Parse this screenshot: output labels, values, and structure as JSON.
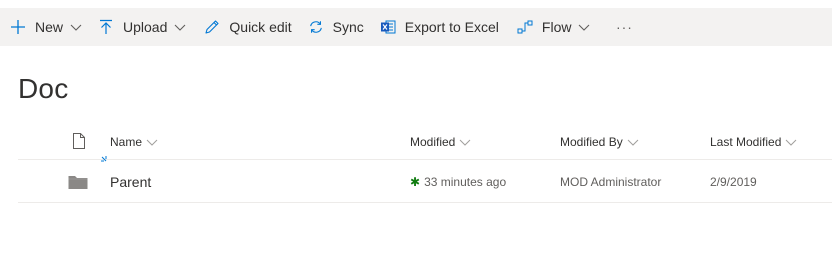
{
  "command_bar": {
    "new_label": "New",
    "upload_label": "Upload",
    "quick_edit_label": "Quick edit",
    "sync_label": "Sync",
    "export_label": "Export to Excel",
    "flow_label": "Flow",
    "more_label": "···"
  },
  "library": {
    "title": "Doc"
  },
  "columns": {
    "name": "Name",
    "modified": "Modified",
    "modified_by": "Modified By",
    "last_modified": "Last Modified"
  },
  "rows": [
    {
      "name": "Parent",
      "modified": "33 minutes ago",
      "modified_by": "MOD Administrator",
      "last_modified": "2/9/2019",
      "is_new": true
    }
  ],
  "colors": {
    "command_bar_bg": "#f3f2f1",
    "accent": "#0078d4",
    "new_indicator": "#107c10",
    "folder": "#8a8886"
  },
  "icons": {
    "new": "plus-icon",
    "upload": "upload-arrow-icon",
    "quick_edit": "pencil-icon",
    "sync": "sync-icon",
    "export": "excel-icon",
    "flow": "flow-icon",
    "file_type_header": "document-icon",
    "row_type": "folder-icon"
  }
}
